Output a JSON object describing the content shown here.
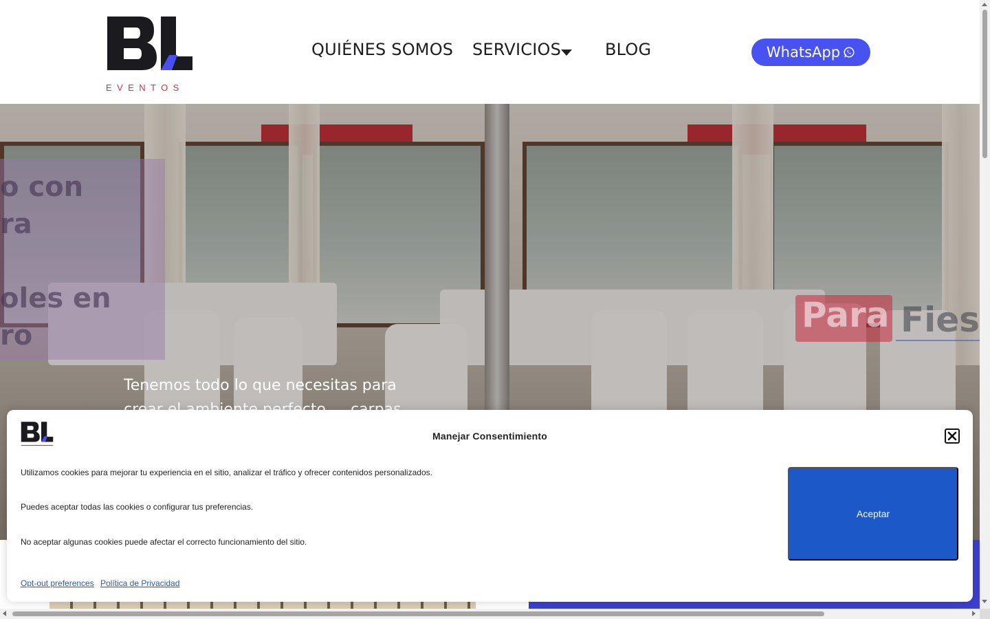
{
  "header": {
    "logo_mark": "BL",
    "logo_text": "EVENTOS",
    "nav": [
      {
        "label": "QUIÉNES SOMOS"
      },
      {
        "label": "SERVICIOS"
      },
      {
        "label": "BLOG"
      }
    ],
    "whatsapp_label": "WhatsApp"
  },
  "hero": {
    "slide_left_lines": [
      "o con",
      "ra",
      "oles en",
      "ro"
    ],
    "badge_word": "Para",
    "badge_word_2": "Fiest",
    "text": "Tenemos todo lo que necesitas para crear el ambiente perfecto … carpas"
  },
  "cookie_dialog": {
    "title": "Manejar Consentimiento",
    "paragraphs": [
      "Utilizamos cookies para mejorar tu experiencia en el sitio, analizar el tráfico y ofrecer contenidos personalizados.",
      "Puedes aceptar todas las cookies o configurar tus preferencias.",
      "No aceptar algunas cookies puede afectar el correcto funcionamiento del sitio."
    ],
    "accept_label": "Aceptar",
    "links": [
      {
        "label": "Opt-out preferences"
      },
      {
        "label": "Política de Privacidad"
      }
    ]
  },
  "colors": {
    "accent": "#4752f0",
    "logo_red": "#c8324a",
    "accept_button": "#1d58c8"
  },
  "icons": [
    "whatsapp-icon",
    "chevron-down-icon",
    "close-icon"
  ]
}
